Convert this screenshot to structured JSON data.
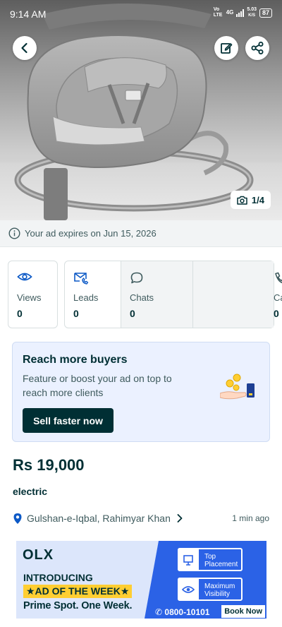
{
  "status_bar": {
    "time": "9:14 AM",
    "network_volte": "Vo LTE",
    "network_4g": "4G",
    "speed_value": "5.03",
    "speed_unit": "K/S",
    "battery": "87"
  },
  "gallery": {
    "counter": "1/4",
    "icons": {
      "back": "back-arrow-icon",
      "edit": "edit-icon",
      "share": "share-icon",
      "camera": "camera-icon"
    }
  },
  "expiry_notice": "Your ad expires on Jun 15, 2026",
  "stats": [
    {
      "label": "Views",
      "value": "0",
      "icon": "eye-icon"
    },
    {
      "label": "Leads",
      "value": "0",
      "icon": "leads-icon"
    },
    {
      "label": "Chats",
      "value": "0",
      "icon": "chat-icon"
    },
    {
      "label": "Calls",
      "value": "0",
      "icon": "phone-icon"
    }
  ],
  "promo": {
    "heading": "Reach more buyers",
    "body": "Feature or boost your ad on top to reach more clients",
    "button": "Sell faster now"
  },
  "listing": {
    "price": "Rs 19,000",
    "title": "electric",
    "location": "Gulshan-e-Iqbal, Rahimyar Khan",
    "posted": "1 min ago"
  },
  "banner_ad": {
    "logo": "OLX",
    "line1": "INTRODUCING",
    "line2": "★AD OF THE WEEK★",
    "line3": "Prime Spot. One Week.",
    "feature1": "Top Placement",
    "feature2": "Maximum Visibility",
    "phone": "0800-10101",
    "cta": "Book Now"
  },
  "colors": {
    "primary_text": "#002f34",
    "secondary_text": "#3f5b5e",
    "promo_bg": "#ebf1ff",
    "banner_blue": "#2b62e6",
    "banner_yellow": "#ffce32"
  }
}
